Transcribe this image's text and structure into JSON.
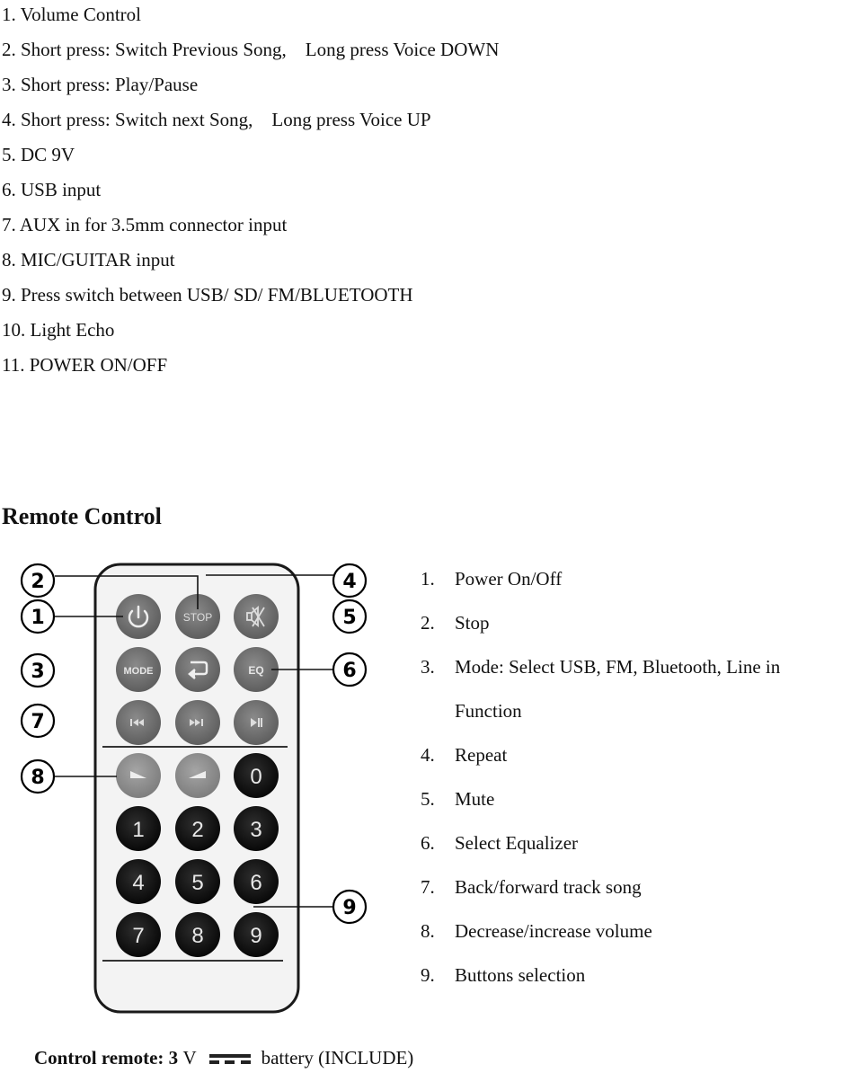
{
  "speaker_features": [
    "1. Volume Control",
    "2. Short press: Switch Previous Song,    Long press Voice DOWN",
    "3. Short press: Play/Pause",
    "4. Short press: Switch next Song,    Long press Voice UP",
    "5. DC 9V",
    "6. USB input",
    "7. AUX in for 3.5mm connector input",
    "8. MIC/GUITAR input",
    "9. Press switch between USB/ SD/ FM/BLUETOOTH",
    "10. Light Echo",
    "11. POWER ON/OFF"
  ],
  "remote_section": {
    "title": "Remote Control",
    "figure": {
      "callouts_left": [
        "2",
        "1",
        "3",
        "7",
        "8"
      ],
      "callouts_right": [
        "4",
        "5",
        "6",
        "9"
      ],
      "buttons": {
        "row1": [
          {
            "label": "",
            "icon": "power-icon",
            "color": "#6e6e6e"
          },
          {
            "label": "STOP",
            "icon": "",
            "color": "#7a7a7a"
          },
          {
            "label": "",
            "icon": "mute-icon",
            "color": "#6e6e6e"
          }
        ],
        "row2": [
          {
            "label": "MODE",
            "icon": "",
            "color": "#6e6e6e"
          },
          {
            "label": "",
            "icon": "repeat-icon",
            "color": "#777777"
          },
          {
            "label": "EQ",
            "icon": "",
            "color": "#6e6e6e"
          }
        ],
        "row3": [
          {
            "label": "",
            "icon": "previous-track-icon",
            "color": "#6e6e6e"
          },
          {
            "label": "",
            "icon": "next-track-icon",
            "color": "#777777"
          },
          {
            "label": "",
            "icon": "play-pause-icon",
            "color": "#6e6e6e"
          }
        ],
        "row4": [
          {
            "label": "",
            "icon": "volume-down-icon",
            "color": "#8c8c8c"
          },
          {
            "label": "",
            "icon": "volume-up-icon",
            "color": "#8c8c8c"
          },
          {
            "label": "0",
            "icon": "",
            "color": "#151515"
          }
        ],
        "digits": [
          "1",
          "2",
          "3",
          "4",
          "5",
          "6",
          "7",
          "8",
          "9"
        ]
      }
    },
    "legend": [
      {
        "num": "1.",
        "text": "Power On/Off"
      },
      {
        "num": "2.",
        "text": "Stop"
      },
      {
        "num": "3.",
        "text": "Mode: Select USB, FM, Bluetooth, Line in Function"
      },
      {
        "num": "4.",
        "text": "Repeat"
      },
      {
        "num": "5.",
        "text": "Mute"
      },
      {
        "num": "6.",
        "text": "Select Equalizer"
      },
      {
        "num": "7.",
        "text": "Back/forward track song"
      },
      {
        "num": "8.",
        "text": "Decrease/increase volume"
      },
      {
        "num": "9.",
        "text": "Buttons selection"
      }
    ]
  },
  "footer": {
    "label_bold": "Control remote: 3",
    "unit": "V",
    "dc_symbol": "dc-symbol-icon",
    "suffix": "battery (INCLUDE)"
  }
}
